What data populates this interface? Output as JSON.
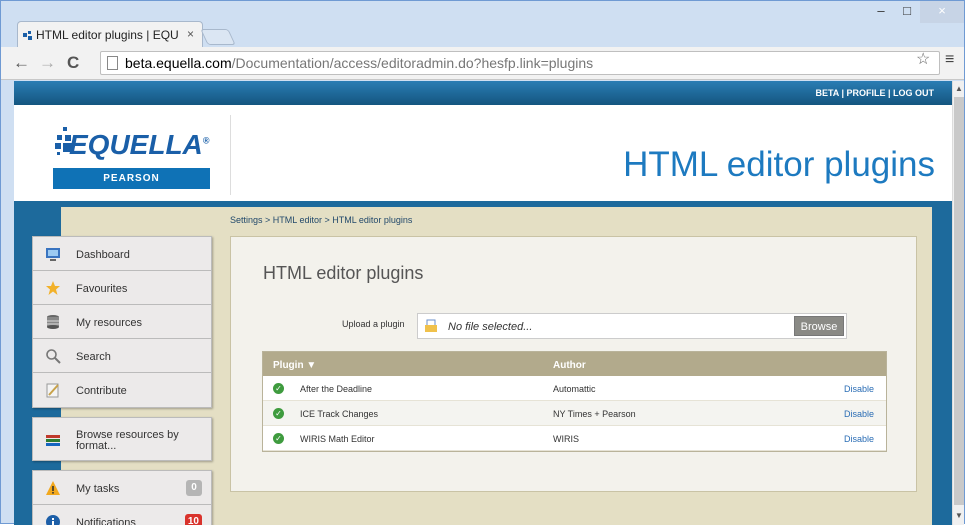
{
  "browser": {
    "tab_title": "HTML editor plugins | EQU",
    "tab_close": "×",
    "minimize": "–",
    "maximize": "□",
    "close": "×",
    "url_host": "beta.equella.com",
    "url_path": "/Documentation/access/editoradmin.do?hesfp.link=plugins",
    "back": "←",
    "forward": "→",
    "reload": "C",
    "star": "☆",
    "menu": "≡"
  },
  "topbar": {
    "links": "BETA | PROFILE | LOG OUT"
  },
  "header": {
    "logo_text": "EQUELLA",
    "logo_mark": "®",
    "logo_sub": "PEARSON",
    "title": "HTML editor plugins"
  },
  "breadcrumb": "Settings > HTML editor > HTML editor plugins",
  "sidebar": {
    "group1": [
      {
        "label": "Dashboard",
        "icon": "dashboard-icon"
      },
      {
        "label": "Favourites",
        "icon": "star-icon"
      },
      {
        "label": "My resources",
        "icon": "database-icon"
      },
      {
        "label": "Search",
        "icon": "search-icon"
      },
      {
        "label": "Contribute",
        "icon": "contribute-icon"
      }
    ],
    "group2": [
      {
        "label": "Browse resources by format...",
        "icon": "books-icon"
      }
    ],
    "group3": [
      {
        "label": "My tasks",
        "count": "0",
        "count_color": "#b5b5b5"
      },
      {
        "label": "Notifications",
        "count": "10",
        "count_color": "#d9332c"
      }
    ]
  },
  "main": {
    "title": "HTML editor plugins",
    "upload_label": "Upload a plugin",
    "file_placeholder": "No file selected...",
    "browse_label": "Browse",
    "table": {
      "col_plugin": "Plugin ▼",
      "col_author": "Author",
      "rows": [
        {
          "plugin": "After the Deadline",
          "author": "Automattic",
          "action": "Disable"
        },
        {
          "plugin": "ICE Track Changes",
          "author": "NY Times + Pearson",
          "action": "Disable"
        },
        {
          "plugin": "WIRIS Math Editor",
          "author": "WIRIS",
          "action": "Disable"
        }
      ]
    }
  },
  "colors": {
    "accent": "#1d7ac0",
    "page_bg": "#1d6a9c",
    "content_bg": "#e4dfc4"
  }
}
